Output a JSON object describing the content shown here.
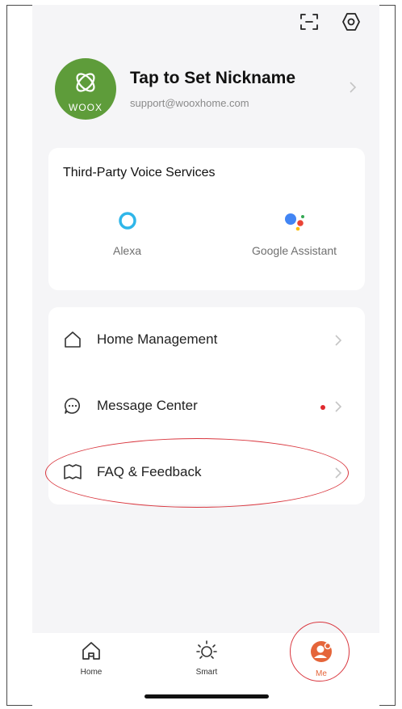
{
  "profile": {
    "nickname": "Tap to Set Nickname",
    "email": "support@wooxhome.com",
    "avatar_text": "WOOX"
  },
  "voice_services": {
    "title": "Third-Party Voice Services",
    "items": [
      {
        "label": "Alexa",
        "icon": "alexa-icon"
      },
      {
        "label": "Google Assistant",
        "icon": "google-assistant-icon"
      }
    ]
  },
  "menu": {
    "items": [
      {
        "label": "Home Management",
        "icon": "house-icon"
      },
      {
        "label": "Message Center",
        "icon": "message-icon",
        "badge": "dot"
      },
      {
        "label": "FAQ & Feedback",
        "icon": "book-icon"
      }
    ]
  },
  "tabs": [
    {
      "label": "Home",
      "icon": "home-tab-icon"
    },
    {
      "label": "Smart",
      "icon": "sun-icon"
    },
    {
      "label": "Me",
      "icon": "person-icon",
      "active": true
    }
  ],
  "colors": {
    "avatar_green": "#5e9c3a",
    "accent_orange": "#e5653a",
    "highlight_red": "#d9363e",
    "alexa_blue": "#2fb6e9"
  }
}
